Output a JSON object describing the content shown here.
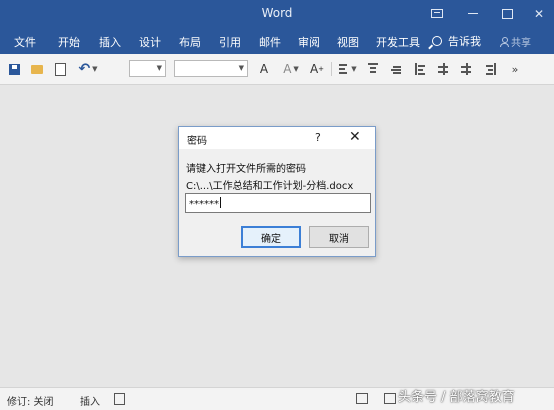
{
  "window": {
    "title": "Word"
  },
  "ribbon": {
    "tabs": [
      "文件",
      "开始",
      "插入",
      "设计",
      "布局",
      "引用",
      "邮件",
      "审阅",
      "视图",
      "开发工具"
    ],
    "search_label": "告诉我",
    "share_label": "共享"
  },
  "toolbar": {
    "font_name": "",
    "font_size": "",
    "icons": [
      "save-icon",
      "open-folder-icon",
      "new-document-icon",
      "undo-icon",
      "grow-font-icon",
      "shrink-font-icon",
      "clear-format-icon",
      "paragraph-icons",
      "more-icon"
    ],
    "grow_letter": "A",
    "shrink_letter": "A",
    "clear_letter": "A",
    "more": "»"
  },
  "dialog": {
    "title": "密码",
    "help": "?",
    "close": "✕",
    "prompt": "请键入打开文件所需的密码",
    "path": "C:\\...\\工作总结和工作计划-分档.docx",
    "password_value": "******",
    "ok_label": "确定",
    "cancel_label": "取消"
  },
  "statusbar": {
    "track_changes": "修订: 关闭",
    "insert_mode": "插入"
  },
  "watermark": "头条号 / 部落窝教育",
  "colors": {
    "ribbon": "#2b579a",
    "background": "#e6e6e6",
    "focus": "#3c7fd6"
  }
}
